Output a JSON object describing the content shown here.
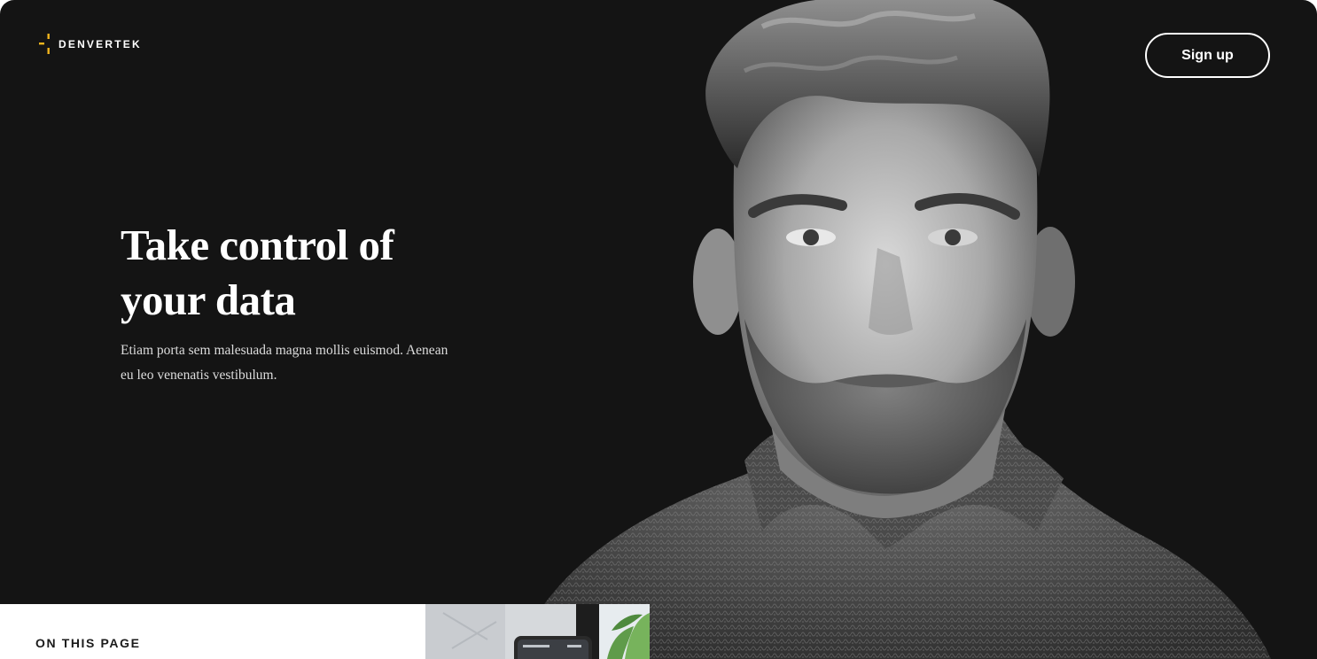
{
  "brand": {
    "name": "DENVERTEK",
    "accent_color": "#f2b51d",
    "mark_icon": "crosshair-mark"
  },
  "nav": {
    "signup_label": "Sign up"
  },
  "hero": {
    "title_lines": [
      "Take control of",
      "your data"
    ],
    "body_lines": [
      "Etiam porta sem malesuada magna mollis euismod. Aenean",
      "eu leo venenatis vestibulum."
    ],
    "background_color": "#141414"
  },
  "toc": {
    "heading": "ON THIS PAGE"
  }
}
